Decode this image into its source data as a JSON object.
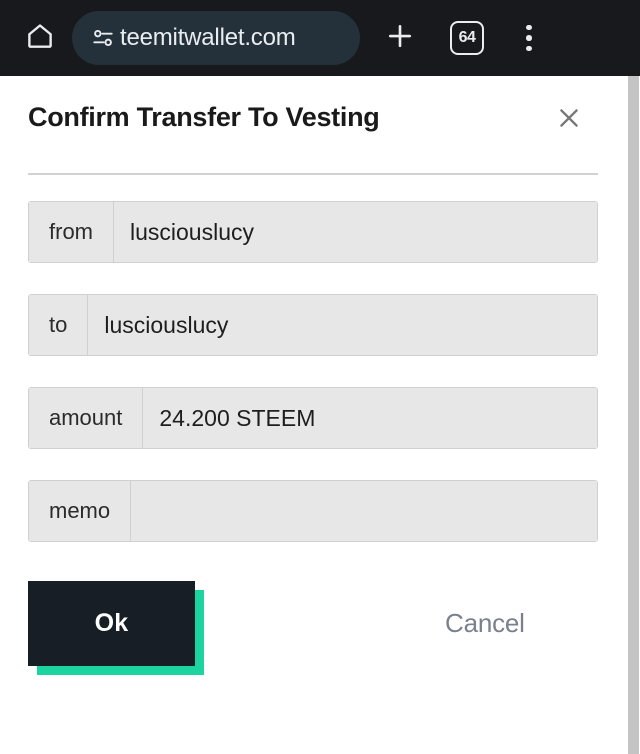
{
  "browser": {
    "home_icon": "home-icon",
    "site_settings_icon": "tune-sliders-icon",
    "url": "teemitwallet.com",
    "new_tab_icon": "plus-icon",
    "tab_count": "64",
    "menu_icon": "three-dot-menu-icon"
  },
  "dialog": {
    "title": "Confirm Transfer To Vesting",
    "close_icon": "close-x-icon",
    "fields": [
      {
        "label": "from",
        "value": "lusciouslucy"
      },
      {
        "label": "to",
        "value": "lusciouslucy"
      },
      {
        "label": "amount",
        "value": "24.200 STEEM"
      },
      {
        "label": "memo",
        "value": ""
      }
    ],
    "ok_label": "Ok",
    "cancel_label": "Cancel"
  },
  "colors": {
    "browser_bar": "#17191C",
    "url_pill": "#25313A",
    "accent_teal": "#1BD4A0",
    "ok_dark": "#171E26",
    "field_bg": "#E7E7E7",
    "cancel_gray": "#78818C",
    "scrollbar": "#C4C4C4"
  }
}
